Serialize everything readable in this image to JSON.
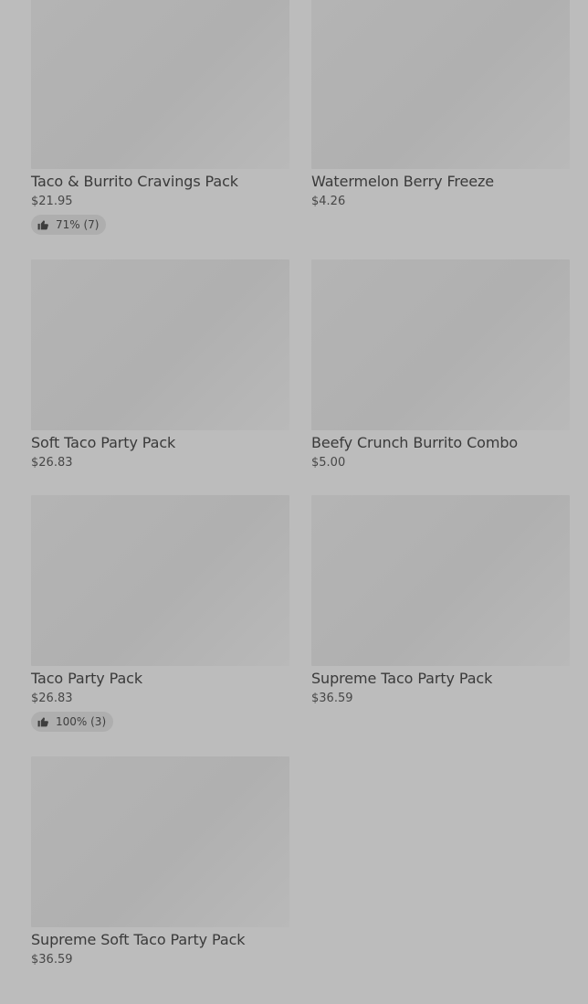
{
  "products": [
    {
      "name": "Taco & Burrito Cravings Pack",
      "price": "$21.95",
      "rating": "71% (7)"
    },
    {
      "name": "Watermelon Berry Freeze",
      "price": "$4.26"
    },
    {
      "name": "Soft Taco Party Pack",
      "price": "$26.83"
    },
    {
      "name": "Beefy Crunch Burrito Combo",
      "price": "$5.00"
    },
    {
      "name": "Taco Party Pack",
      "price": "$26.83",
      "rating": "100% (3)"
    },
    {
      "name": "Supreme Taco Party Pack",
      "price": "$36.59"
    },
    {
      "name": "Supreme Soft Taco Party Pack",
      "price": "$36.59"
    }
  ],
  "icons": {
    "rating": "thumbs-up-icon"
  },
  "colors": {
    "background": "#bcbcbc",
    "image_placeholder": "#b2b2b2",
    "text": "#3a3a3a",
    "rating_badge": "#aeaeae"
  }
}
